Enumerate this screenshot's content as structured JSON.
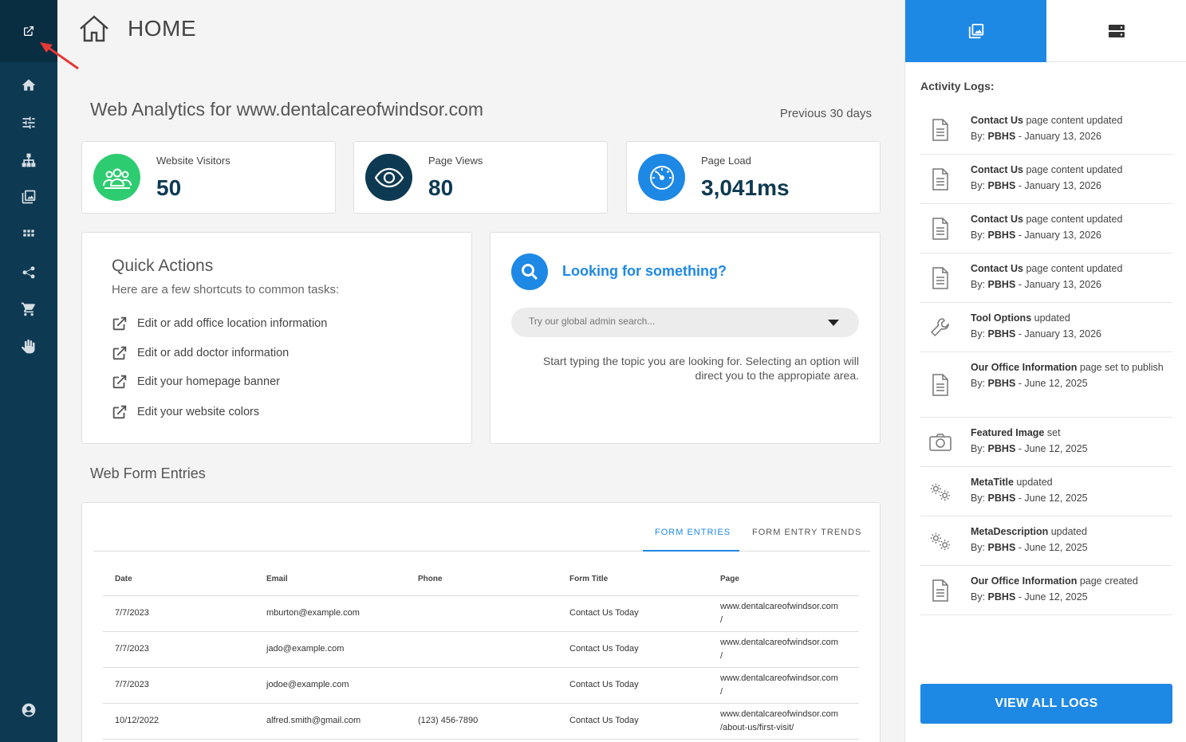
{
  "page": {
    "title": "HOME"
  },
  "analytics": {
    "title": "Web Analytics for www.dentalcareofwindsor.com",
    "period": "Previous 30 days",
    "stats": [
      {
        "label": "Website Visitors",
        "value": "50",
        "icon": "users-icon",
        "color": "#2ecc71"
      },
      {
        "label": "Page Views",
        "value": "80",
        "icon": "eye-icon",
        "color": "#0d3a52"
      },
      {
        "label": "Page Load",
        "value": "3,041ms",
        "icon": "speedometer-icon",
        "color": "#1e88e5"
      }
    ]
  },
  "quick_actions": {
    "title": "Quick Actions",
    "subtitle": "Here are a few shortcuts to common tasks:",
    "items": [
      {
        "label": "Edit or add office location information"
      },
      {
        "label": "Edit or add doctor information"
      },
      {
        "label": "Edit your homepage banner"
      },
      {
        "label": "Edit your website colors"
      }
    ]
  },
  "search": {
    "title": "Looking for something?",
    "placeholder": "Try our global admin search...",
    "help": "Start typing the topic you are looking for. Selecting an option will direct you to the appropiate area."
  },
  "web_forms": {
    "title": "Web Form Entries",
    "tabs": [
      "FORM ENTRIES",
      "FORM ENTRY TRENDS"
    ],
    "columns": [
      "Date",
      "Email",
      "Phone",
      "Form Title",
      "Page"
    ],
    "rows": [
      {
        "date": "7/7/2023",
        "email": "mburton@example.com",
        "phone": "",
        "form": "Contact Us Today",
        "page1": "www.dentalcareofwindsor.com",
        "page2": "/"
      },
      {
        "date": "7/7/2023",
        "email": "jado@example.com",
        "phone": "",
        "form": "Contact Us Today",
        "page1": "www.dentalcareofwindsor.com",
        "page2": "/"
      },
      {
        "date": "7/7/2023",
        "email": "jodoe@example.com",
        "phone": "",
        "form": "Contact Us Today",
        "page1": "www.dentalcareofwindsor.com",
        "page2": "/"
      },
      {
        "date": "10/12/2022",
        "email": "alfred.smith@gmail.com",
        "phone": "(123) 456-7890",
        "form": "Contact Us Today",
        "page1": "www.dentalcareofwindsor.com",
        "page2": "/about-us/first-visit/"
      }
    ]
  },
  "activity": {
    "title": "Activity Logs:",
    "by_label": "By:",
    "logs": [
      {
        "icon": "document-icon",
        "subject": "Contact Us",
        "action": " page content updated",
        "user": "PBHS",
        "date": " - January 13, 2026"
      },
      {
        "icon": "document-icon",
        "subject": "Contact Us",
        "action": " page content updated",
        "user": "PBHS",
        "date": " - January 13, 2026"
      },
      {
        "icon": "document-icon",
        "subject": "Contact Us",
        "action": " page content updated",
        "user": "PBHS",
        "date": " - January 13, 2026"
      },
      {
        "icon": "document-icon",
        "subject": "Contact Us",
        "action": " page content updated",
        "user": "PBHS",
        "date": " - January 13, 2026"
      },
      {
        "icon": "wrench-icon",
        "subject": "Tool Options",
        "action": " updated",
        "user": "PBHS",
        "date": " - January 13, 2026"
      },
      {
        "icon": "document-icon",
        "subject": "Our Office Information",
        "action": " page set to publish",
        "user": "PBHS",
        "date": " - June 12, 2025"
      },
      {
        "icon": "camera-icon",
        "subject": "Featured Image",
        "action": " set",
        "user": "PBHS",
        "date": " - June 12, 2025"
      },
      {
        "icon": "gears-icon",
        "subject": "MetaTitle",
        "action": " updated",
        "user": "PBHS",
        "date": " - June 12, 2025"
      },
      {
        "icon": "gears-icon",
        "subject": "MetaDescription",
        "action": " updated",
        "user": "PBHS",
        "date": " - June 12, 2025"
      },
      {
        "icon": "document-icon",
        "subject": "Our Office Information",
        "action": " page created",
        "user": "PBHS",
        "date": " - June 12, 2025"
      }
    ],
    "view_all": "VIEW ALL LOGS"
  },
  "sidebar": {
    "icons": [
      "external-link-icon",
      "home-icon",
      "sliders-icon",
      "sitemap-icon",
      "images-icon",
      "apps-grid-icon",
      "share-icon",
      "cart-icon",
      "hand-icon",
      "user-circle-icon"
    ]
  },
  "colors": {
    "sidebar": "#0d3a52",
    "accent": "#1e88e5",
    "green": "#2ecc71"
  }
}
